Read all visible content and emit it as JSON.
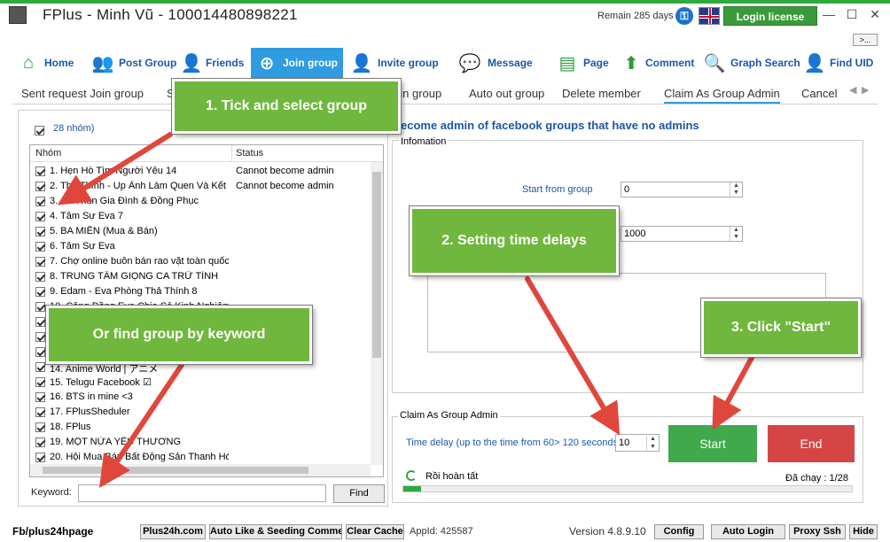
{
  "window": {
    "title": "FPlus - Minh Vũ - 100014480898221",
    "remain": "Remain 285 days",
    "login_license": "Login license",
    "more": ">..."
  },
  "nav": {
    "home": "Home",
    "post_group": "Post Group",
    "friends": "Friends",
    "join_group": "Join group",
    "invite_group": "Invite group",
    "message": "Message",
    "page": "Page",
    "comment": "Comment",
    "graph_search": "Graph Search",
    "find_uid": "Find UID"
  },
  "subtabs": {
    "sent_request": "Sent request Join group",
    "s": "S",
    "join_group_partial": "oin group",
    "auto_out": "Auto out group",
    "delete_member": "Delete member",
    "claim_admin": "Claim As Group Admin",
    "cancel_partial": "Cancel"
  },
  "left": {
    "group_count": "28 nhóm)",
    "col_group": "Nhóm",
    "col_status": "Status",
    "rows": [
      {
        "name": "1. Hẹn Hò Tìm Người Yêu 14",
        "status": "Cannot become admin"
      },
      {
        "name": "2. Thả Thính - Up Ảnh Làm Quen Và Kết Bạn",
        "status": "Cannot become admin"
      },
      {
        "name": "3. Áo Thun Gia Đình & Đồng Phục",
        "status": ""
      },
      {
        "name": "4. Tâm Sự Eva 7",
        "status": ""
      },
      {
        "name": "5. BA MIỀN (Mua & Bán)",
        "status": ""
      },
      {
        "name": "6. Tâm Sự Eva",
        "status": ""
      },
      {
        "name": "7. Chợ online buôn bán rao vặt toàn quốc",
        "status": ""
      },
      {
        "name": "8. TRUNG TÂM GIỌNG CA TRỮ TÌNH",
        "status": ""
      },
      {
        "name": "9. Edam - Eva Phòng Thả Thính 8",
        "status": ""
      },
      {
        "name": "10. Cộng Đồng Eva Chia Sẻ Kinh Nghiệm",
        "status": ""
      },
      {
        "name": "11.",
        "status": ""
      },
      {
        "name": "12.",
        "status": ""
      },
      {
        "name": "13.",
        "status": ""
      },
      {
        "name": "14. Anime World | アニメ",
        "status": ""
      },
      {
        "name": "15. Telugu Facebook ☑",
        "status": ""
      },
      {
        "name": "16. BTS in mine <3",
        "status": ""
      },
      {
        "name": "17. FPlusSheduler",
        "status": ""
      },
      {
        "name": "18. FPlus",
        "status": ""
      },
      {
        "name": "19. MỘT NỬA YÊU THƯƠNG",
        "status": ""
      },
      {
        "name": "20. Hội Mua Bán Bất Động Sản Thanh Hóa",
        "status": ""
      }
    ],
    "keyword_label": "Keyword:",
    "keyword_value": "",
    "find": "Find"
  },
  "right": {
    "title": "ecome admin of facebook groups that have no admins",
    "info_legend": "Infomation",
    "start_from_label": "Start from group",
    "start_from_value": "0",
    "delay_value": "1000",
    "claim_legend": "Claim As Group Admin",
    "time_delay_label": "Time delay (up to the time from 60> 120 seconds)",
    "time_delay_value": "10",
    "start": "Start",
    "end": "End",
    "status": "Rồi hoàn tất",
    "ran": "Đã chạy : 1/28",
    "progress": 0.04
  },
  "footer": {
    "fb": "Fb/plus24hpage",
    "plus24h": "Plus24h.com",
    "auto_like": "Auto Like & Seeding Comment",
    "clear_cache": "Clear Cache",
    "appid": "AppId: 425587",
    "version": "Version 4.8.9.10",
    "config": "Config",
    "auto_login": "Auto Login",
    "proxy_ssh": "Proxy Ssh",
    "hide": "Hide"
  },
  "callouts": {
    "c1": "1. Tick and select group",
    "c2": "2. Setting time delays",
    "c3": "3. Click \"Start\"",
    "c4": "Or find group by keyword"
  },
  "colors": {
    "accent_green": "#2faa3f",
    "start_green": "#3fa94b",
    "end_red": "#d64545",
    "link_blue": "#1b57a8",
    "callout_green": "#6fb73d",
    "arrow_red": "#e0473c"
  }
}
